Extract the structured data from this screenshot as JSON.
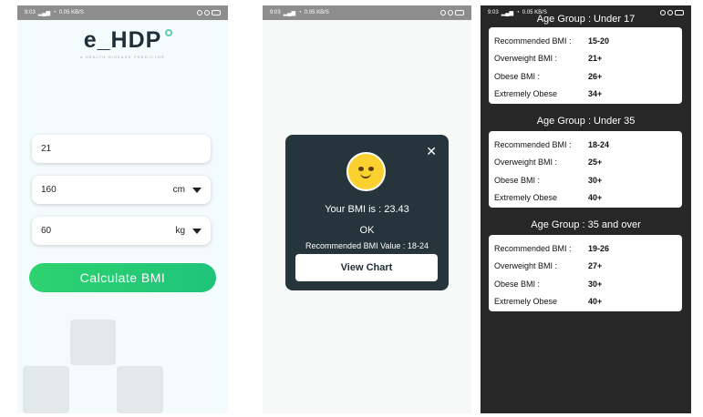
{
  "status_bar": {
    "time": "9:03",
    "speed": "0.05 KB/S"
  },
  "screen1": {
    "logo": "e_HDP",
    "tagline": "A HEALTH DISEASE PREDICTOR",
    "age_value": "21",
    "height_value": "160",
    "height_unit": "cm",
    "weight_value": "60",
    "weight_unit": "kg",
    "calculate_label": "Calculate BMI"
  },
  "screen2": {
    "close_icon": "close-icon",
    "bmi_text": "Your BMI is : 23.43",
    "status_text": "OK",
    "recommended_text": "Recommended BMI Value : 18-24",
    "view_chart_label": "View Chart"
  },
  "screen3": {
    "groups": [
      {
        "title": "Age Group : Under 17",
        "rows": [
          {
            "label": "Recommended BMI :",
            "value": "15-20"
          },
          {
            "label": "Overweight BMI :",
            "value": "21+"
          },
          {
            "label": "Obese BMI :",
            "value": "26+"
          },
          {
            "label": "Extremely Obese",
            "value": "34+"
          }
        ]
      },
      {
        "title": "Age Group : Under 35",
        "rows": [
          {
            "label": "Recommended BMI :",
            "value": "18-24"
          },
          {
            "label": "Overweight BMI :",
            "value": "25+"
          },
          {
            "label": "Obese BMI :",
            "value": "30+"
          },
          {
            "label": "Extremely Obese",
            "value": "40+"
          }
        ]
      },
      {
        "title": "Age Group : 35 and over",
        "rows": [
          {
            "label": "Recommended BMI :",
            "value": "19-26"
          },
          {
            "label": "Overweight BMI :",
            "value": "27+"
          },
          {
            "label": "Obese BMI :",
            "value": "30+"
          },
          {
            "label": "Extremely Obese",
            "value": "40+"
          }
        ]
      }
    ]
  },
  "colors": {
    "accent_green": "#2ed26f",
    "dialog_bg": "#25353b",
    "dark_bg": "#272727"
  }
}
